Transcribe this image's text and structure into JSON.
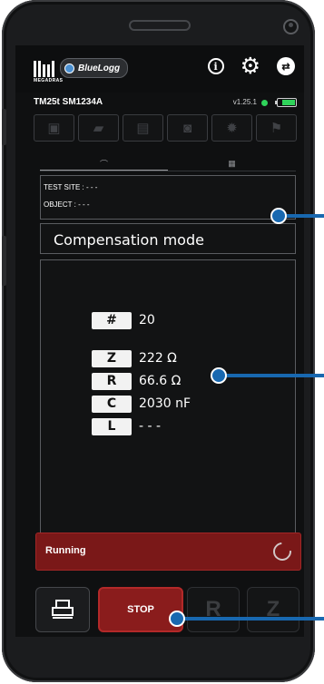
{
  "app": {
    "brand": "MEGADRAS",
    "product": "BlueLogg",
    "device_id": "TM25t  SM1234A",
    "version": "v1.25.1",
    "battery_level": 0.8,
    "status_color": "#2fd35a"
  },
  "header_icons": [
    "info-icon",
    "gear-icon",
    "connection-icon"
  ],
  "toolbar": [
    "save-icon",
    "folder-open-icon",
    "report-icon",
    "camera-icon",
    "locate-icon",
    "map-icon"
  ],
  "tabs": [
    {
      "name": "gauge-tab",
      "icon": "⌒",
      "active": true
    },
    {
      "name": "grid-tab",
      "icon": "▦",
      "active": false
    }
  ],
  "info": {
    "test_site": "TEST SITE : - - -",
    "object": "OBJECT : - - -"
  },
  "mode": "Compensation mode",
  "values": [
    {
      "key": "#",
      "value": "20"
    },
    {
      "key": "Z",
      "value": "222 Ω"
    },
    {
      "key": "R",
      "value": "66.6 Ω"
    },
    {
      "key": "C",
      "value": "2030 nF"
    },
    {
      "key": "L",
      "value": "- - -"
    }
  ],
  "run_status": "Running",
  "buttons": {
    "stop": "STOP",
    "r": "R",
    "z": "Z"
  },
  "colors": {
    "accent_red": "#8a1c1c",
    "callout_blue": "#1868b0"
  }
}
